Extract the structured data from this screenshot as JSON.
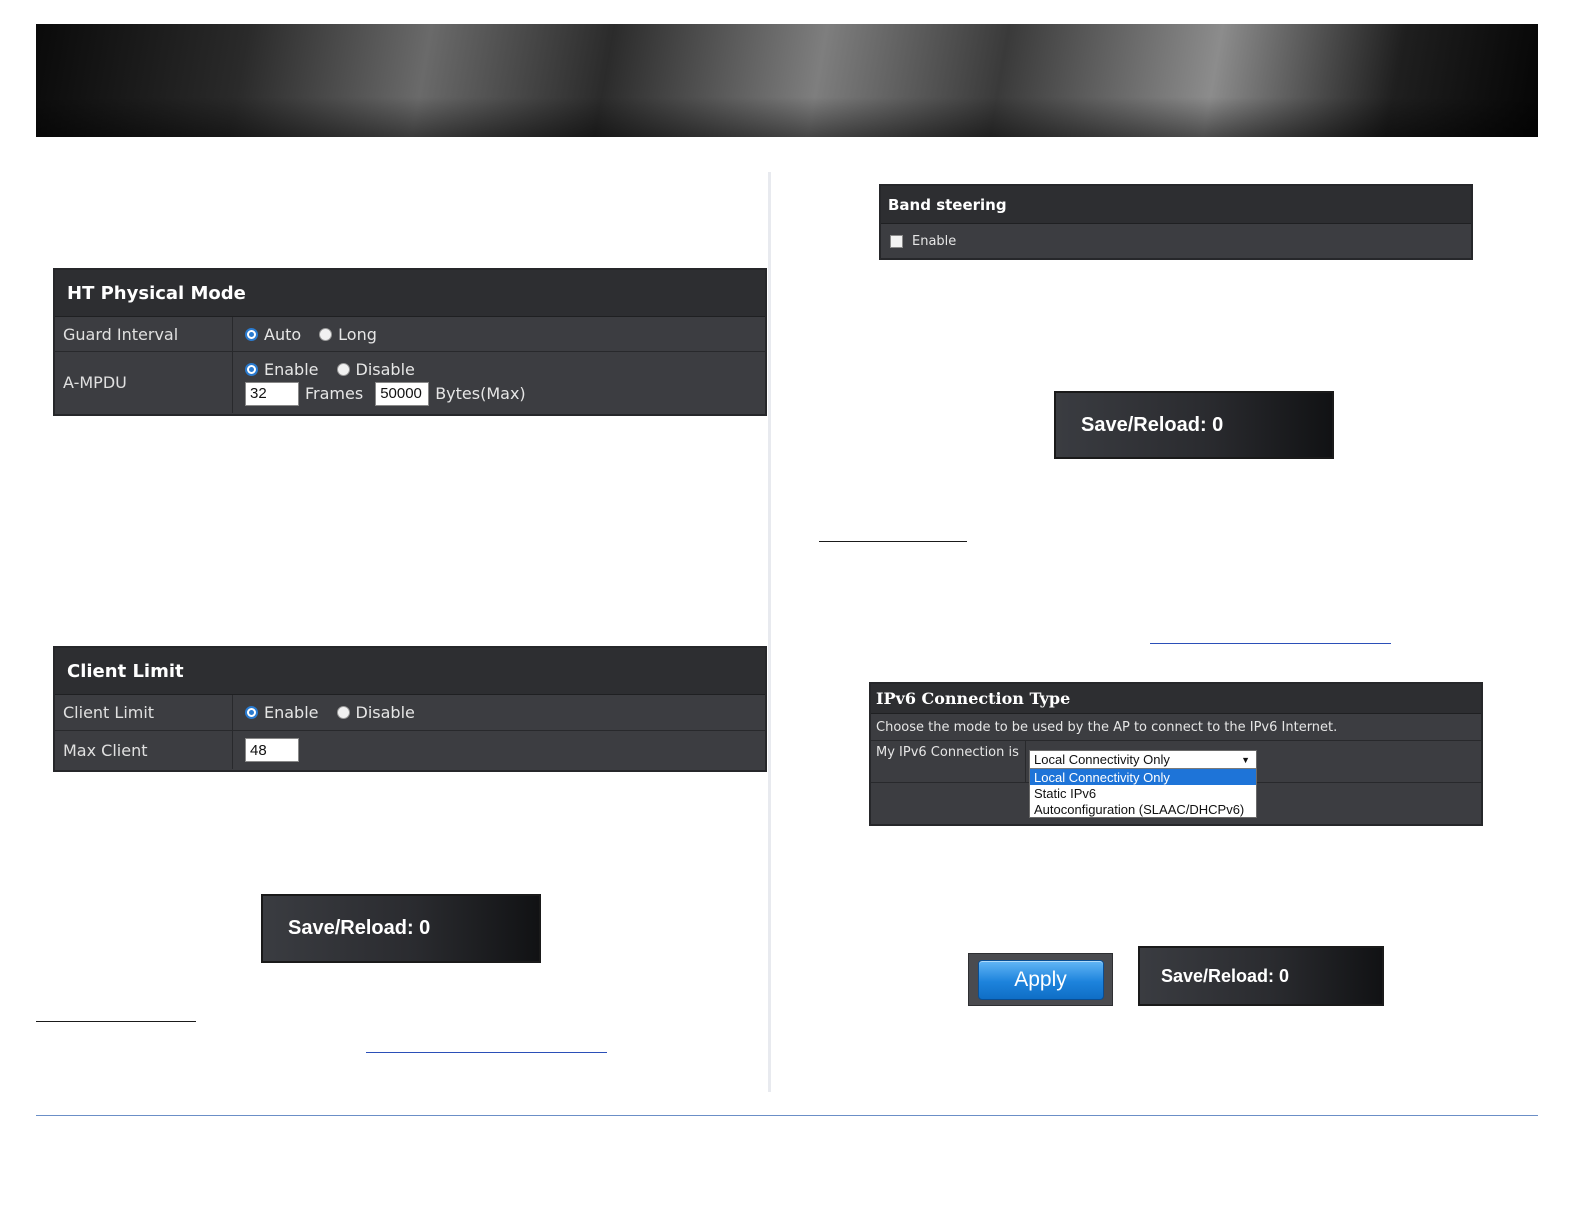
{
  "ht_physical_mode": {
    "title": "HT Physical Mode",
    "guard_interval": {
      "label": "Guard Interval",
      "options": [
        "Auto",
        "Long"
      ],
      "selected": "Auto"
    },
    "ampdu": {
      "label": "A-MPDU",
      "options": [
        "Enable",
        "Disable"
      ],
      "selected": "Enable",
      "frames_value": "32",
      "frames_label": "Frames",
      "bytes_value": "50000",
      "bytes_label": "Bytes(Max)"
    }
  },
  "client_limit": {
    "title": "Client Limit",
    "limit": {
      "label": "Client Limit",
      "options": [
        "Enable",
        "Disable"
      ],
      "selected": "Enable"
    },
    "max_client": {
      "label": "Max Client",
      "value": "48"
    }
  },
  "band_steering": {
    "title": "Band steering",
    "enable_label": "Enable",
    "checked": false
  },
  "save_reload_label": "Save/Reload: 0",
  "ipv6": {
    "title": "IPv6 Connection Type",
    "description": "Choose the mode to be used by the AP to connect to the IPv6 Internet.",
    "connection_label": "My IPv6 Connection is",
    "selected": "Local Connectivity Only",
    "options": [
      "Local Connectivity Only",
      "Static IPv6",
      "Autoconfiguration (SLAAC/DHCPv6)"
    ]
  },
  "apply_label": "Apply",
  "colors": {
    "accent_blue": "#1e74d8",
    "panel_bg": "#3c3d41",
    "panel_title_bg": "#2d2e31"
  },
  "icons": {
    "dropdown_arrow": "caret-down-icon",
    "radio": "radio-icon",
    "checkbox": "checkbox-icon"
  }
}
